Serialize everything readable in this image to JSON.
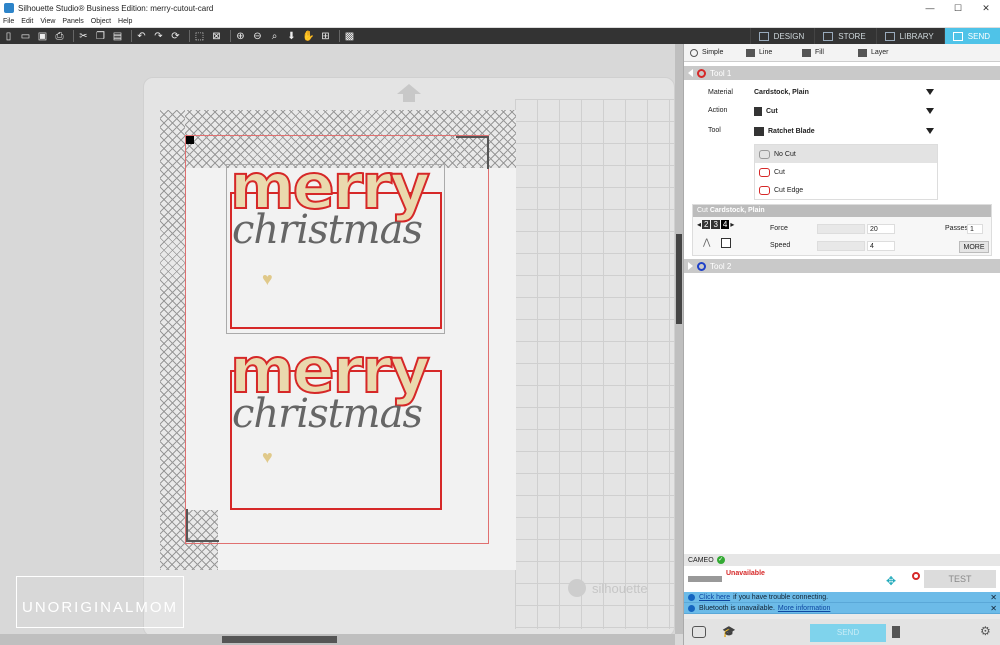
{
  "window": {
    "title": "Silhouette Studio® Business Edition: merry-cutout-card"
  },
  "menu": [
    "File",
    "Edit",
    "View",
    "Panels",
    "Object",
    "Help"
  ],
  "nav_tabs": [
    {
      "label": "DESIGN",
      "icon": "grid-icon"
    },
    {
      "label": "STORE",
      "icon": "store-icon"
    },
    {
      "label": "LIBRARY",
      "icon": "library-icon"
    },
    {
      "label": "SEND",
      "icon": "send-icon",
      "active": true
    }
  ],
  "send_panel": {
    "mode_tabs": [
      "Simple",
      "Line",
      "Fill",
      "Layer"
    ],
    "tool1": {
      "title": "Tool 1",
      "material_label": "Material",
      "material_value": "Cardstock, Plain",
      "action_label": "Action",
      "action_value": "Cut",
      "tool_label": "Tool",
      "tool_value": "Ratchet Blade",
      "action_options": [
        "No Cut",
        "Cut",
        "Cut Edge"
      ],
      "cut_settings_prefix": "Cut",
      "cut_settings_material": "Cardstock, Plain",
      "blade_digits": [
        "2",
        "3",
        "4"
      ],
      "force_label": "Force",
      "force_value": "20",
      "speed_label": "Speed",
      "speed_value": "4",
      "passes_label": "Passes",
      "passes_value": "1",
      "more_label": "MORE"
    },
    "tool2": {
      "title": "Tool 2"
    },
    "device": {
      "name": "CAMEO",
      "status": "Unavailable",
      "test_label": "TEST"
    },
    "messages": [
      {
        "link": "Click here",
        "text": "if you have trouble connecting."
      },
      {
        "text": "Bluetooth is unavailable.",
        "link": "More information"
      }
    ],
    "send_label": "SEND"
  },
  "canvas": {
    "card_word1": "merry",
    "card_word2": "christmas",
    "heart": "♥",
    "watermark": "UNORIGINALMOM",
    "mat_brand": "silhouette"
  },
  "colors": {
    "accent": "#4fc3e8",
    "cut_line": "#d62828",
    "glitter": "#ead9ae"
  }
}
